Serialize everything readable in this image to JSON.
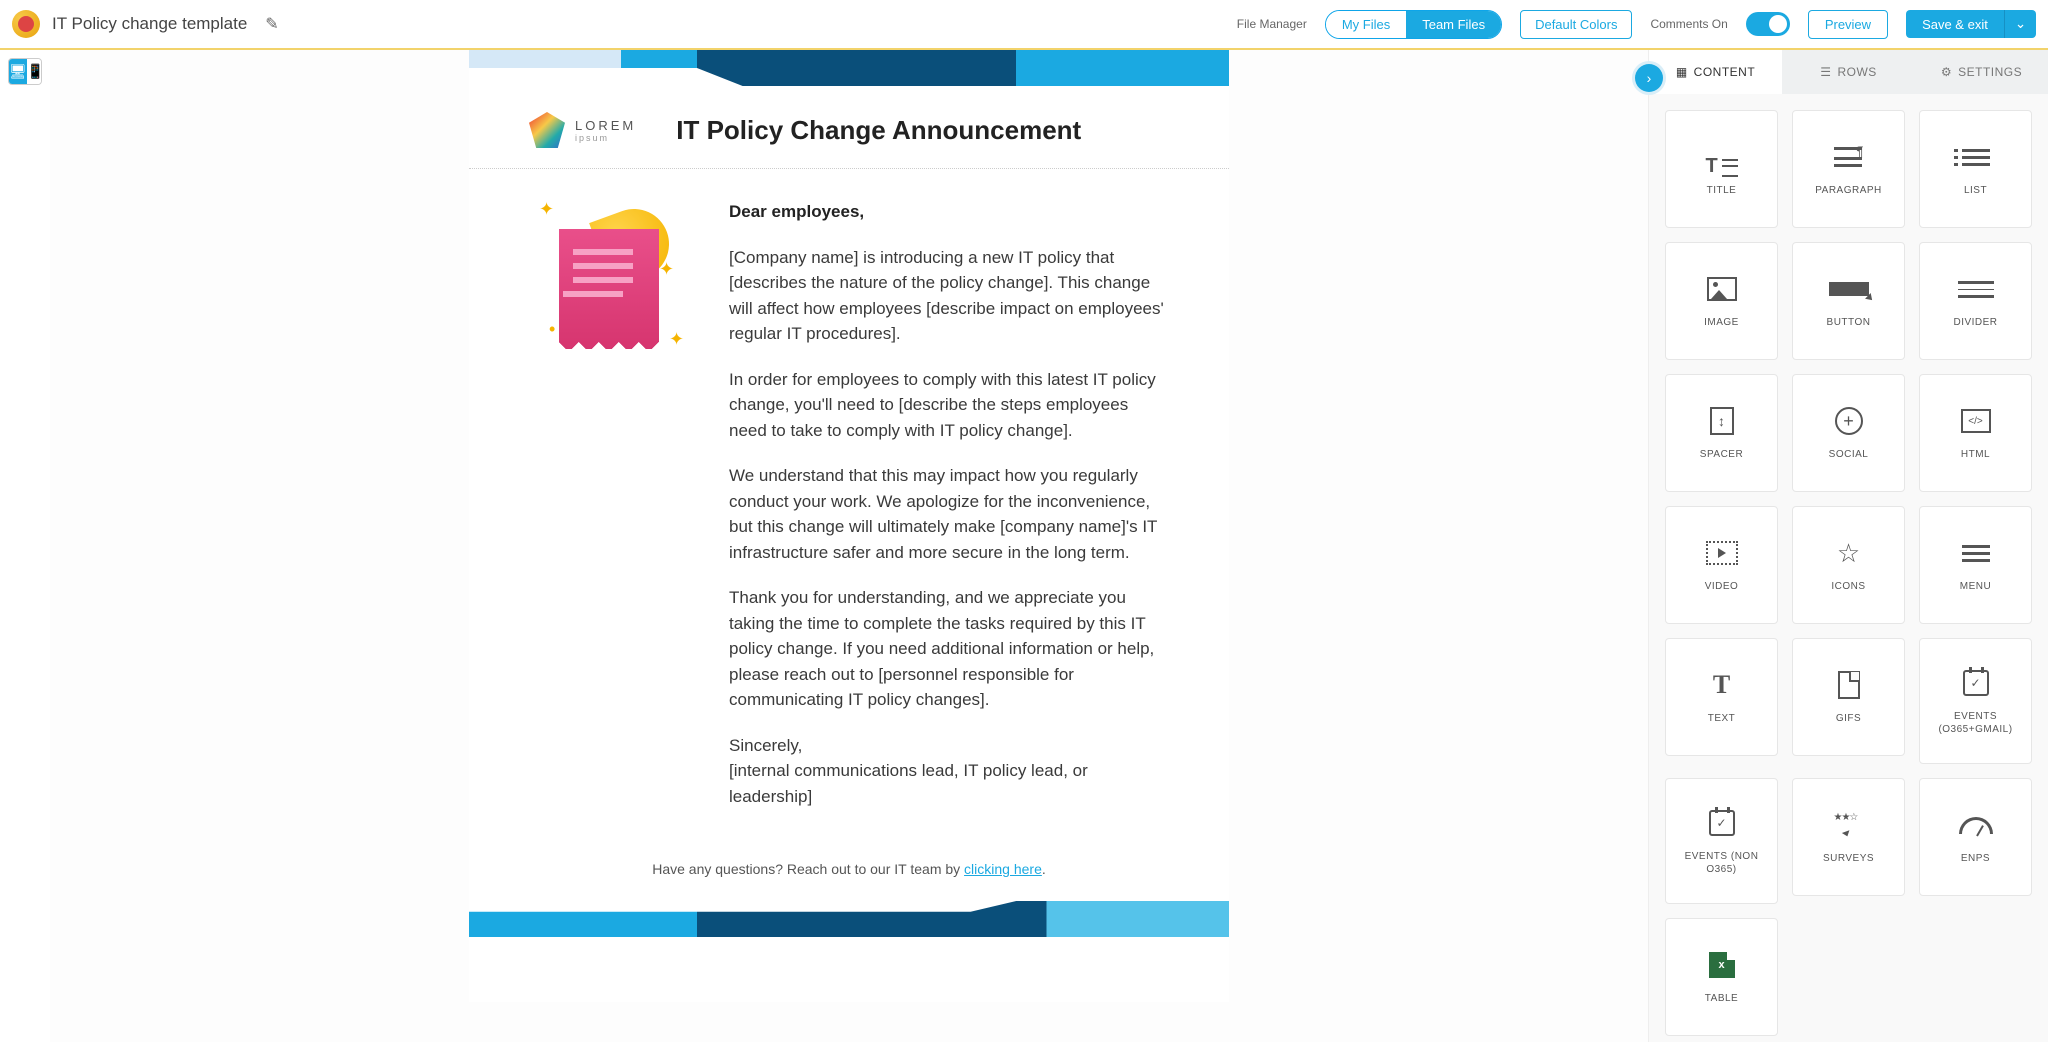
{
  "header": {
    "doc_title": "IT Policy change template",
    "file_manager_label": "File Manager",
    "file_toggle": {
      "my": "My Files",
      "team": "Team Files"
    },
    "default_colors": "Default Colors",
    "comments_label": "Comments On",
    "preview": "Preview",
    "save": "Save & exit"
  },
  "sidebar_tabs": {
    "content": "CONTENT",
    "rows": "ROWS",
    "settings": "SETTINGS"
  },
  "blocks": {
    "title": "TITLE",
    "paragraph": "PARAGRAPH",
    "list": "LIST",
    "image": "IMAGE",
    "button": "BUTTON",
    "divider": "DIVIDER",
    "spacer": "SPACER",
    "social": "SOCIAL",
    "html": "HTML",
    "video": "VIDEO",
    "icons": "ICONS",
    "menu": "MENU",
    "text": "TEXT",
    "gifs": "GIFS",
    "events_o365": "EVENTS (O365+GMAIL)",
    "events_non": "EVENTS (NON O365)",
    "surveys": "SURVEYS",
    "enps": "ENPS",
    "table": "TABLE"
  },
  "email": {
    "brand_name": "LOREM",
    "brand_sub": "ipsum",
    "heading": "IT Policy Change Announcement",
    "greeting": "Dear employees,",
    "p1": "[Company name] is introducing a new IT policy that [describes the nature of the policy change]. This change will affect how employees [describe impact on employees' regular IT procedures].",
    "p2": "In order for employees to comply with this latest IT policy change, you'll need to [describe the steps employees need to take to comply with IT policy change].",
    "p3": "We understand that this may impact how you regularly conduct your work. We apologize for the inconvenience, but this change will ultimately make [company name]'s IT infrastructure safer and more secure in the long term.",
    "p4": "Thank you for understanding, and we appreciate you taking the time to complete the tasks required by this IT policy change. If you need additional information or help, please reach out to [personnel responsible for communicating IT policy changes].",
    "sign1": "Sincerely,",
    "sign2": "[internal communications lead, IT policy lead, or leadership]",
    "footer_pre": "Have any questions? Reach out to our IT team by ",
    "footer_link": "clicking here",
    "footer_post": "."
  }
}
